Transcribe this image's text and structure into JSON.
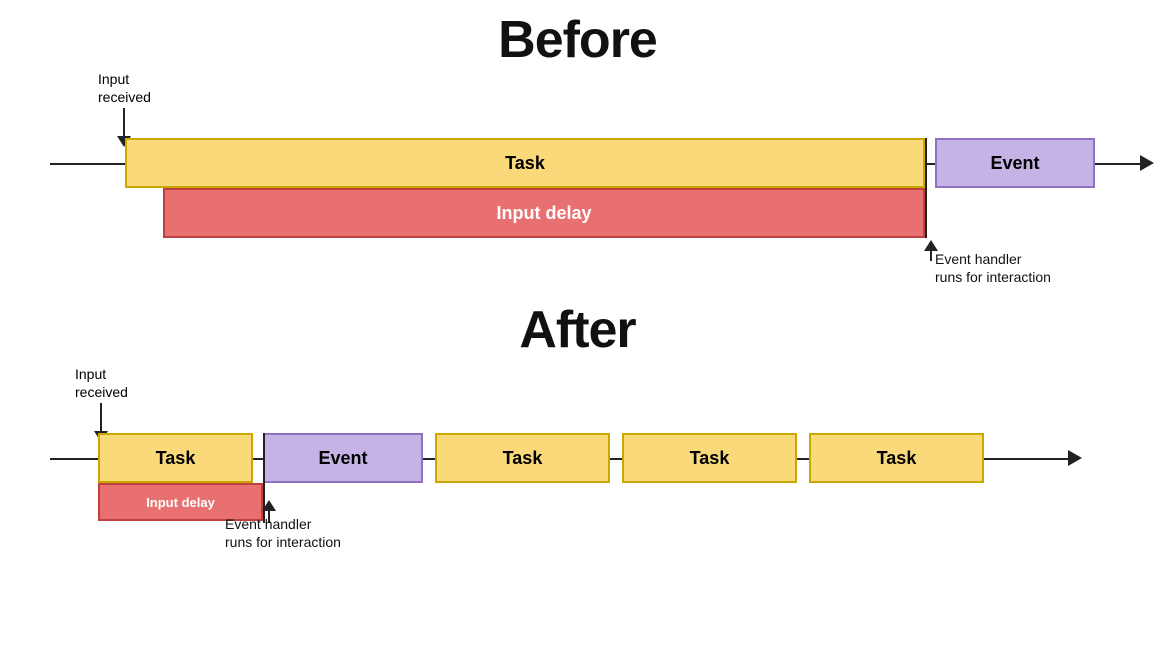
{
  "before": {
    "title": "Before",
    "input_received_label": "Input\nreceived",
    "task_label": "Task",
    "event_label": "Event",
    "input_delay_label": "Input delay",
    "event_handler_label": "Event handler\nruns for interaction"
  },
  "after": {
    "title": "After",
    "input_received_label": "Input\nreceived",
    "task_label": "Task",
    "event_label": "Event",
    "input_delay_label": "Input delay",
    "event_handler_label": "Event handler\nruns for interaction",
    "task2_label": "Task",
    "task3_label": "Task",
    "task4_label": "Task"
  }
}
